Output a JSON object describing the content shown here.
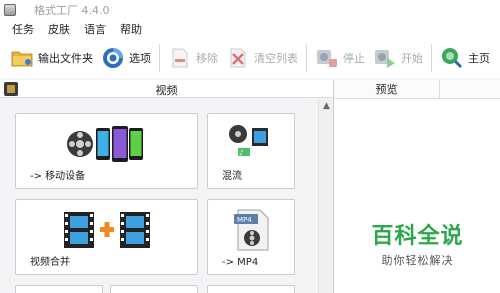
{
  "window": {
    "title": "格式工厂 4.4.0"
  },
  "menu": {
    "items": [
      "任务",
      "皮肤",
      "语言",
      "帮助"
    ]
  },
  "toolbar": {
    "output_folder": "输出文件夹",
    "options": "选项",
    "remove": "移除",
    "clear_list": "清空列表",
    "stop": "停止",
    "start": "开始",
    "home": "主页"
  },
  "left_panel": {
    "title": "视频",
    "tiles": [
      {
        "label": "-> 移动设备",
        "icon": "film-reel-phones-icon"
      },
      {
        "label": "混流",
        "icon": "mux-icon"
      },
      {
        "label": "视频合并",
        "icon": "film-plus-film-icon"
      },
      {
        "label": "-> MP4",
        "icon": "mp4-file-icon",
        "badge": "MP4"
      }
    ]
  },
  "right_panel": {
    "column_preview": "预览"
  },
  "watermark": {
    "title": "百科全说",
    "subtitle": "助你轻松解决"
  },
  "colors": {
    "accent_green": "#2ca84a",
    "disabled_text": "#a7abb0"
  }
}
